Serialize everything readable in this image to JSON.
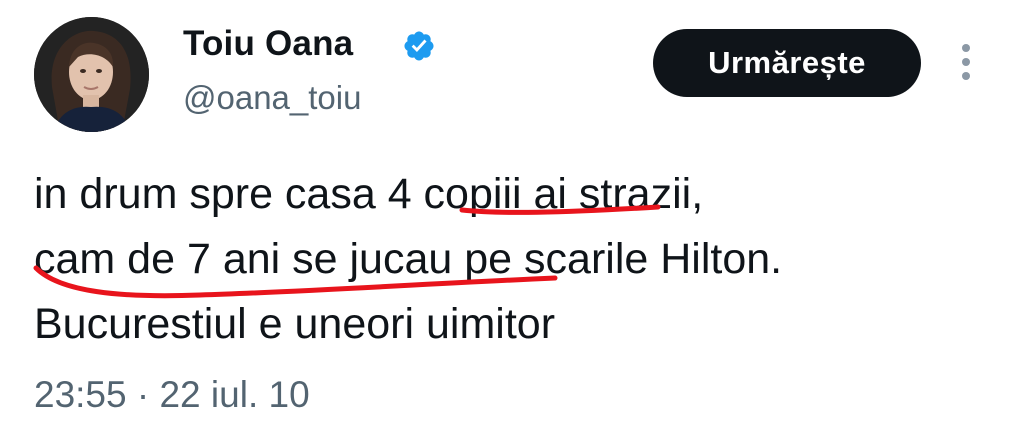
{
  "author": {
    "display_name": "Toiu Oana",
    "handle": "@oana_toiu",
    "verified": true,
    "verified_color": "#1d9bf0"
  },
  "actions": {
    "follow_label": "Urmărește",
    "more_icon": "more-vertical-icon"
  },
  "tweet": {
    "lines": [
      "in drum spre casa 4 copiii ai strazii,",
      "cam de 7 ani se jucau pe scarile Hilton.",
      "Bucurestiul e uneori uimitor"
    ],
    "time": "23:55",
    "separator": "·",
    "date": "22 iul. 10"
  },
  "annotation_color": "#e8141c"
}
